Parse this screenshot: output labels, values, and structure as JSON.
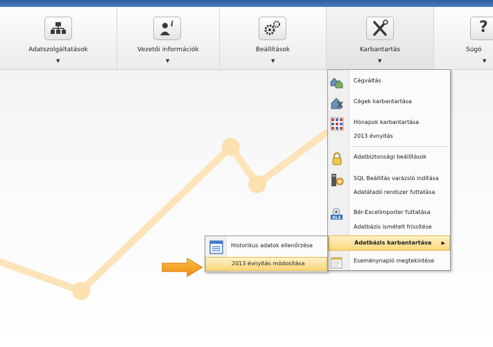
{
  "ribbon": {
    "buttons": [
      {
        "label": "Adatszolgáltatások",
        "icon": "org-chart-icon"
      },
      {
        "label": "Vezetői információk",
        "icon": "user-info-icon"
      },
      {
        "label": "Beállítások",
        "icon": "gears-icon"
      },
      {
        "label": "Karbantartás",
        "icon": "tools-icon"
      },
      {
        "label": "Súgó",
        "icon": "help-icon"
      }
    ],
    "dropdown_arrow": "▼"
  },
  "help_glyph": "?",
  "menu": {
    "items": [
      {
        "label": "Cégváltás",
        "icon": "company-switch-icon"
      },
      {
        "label": "Cégek karbantartása",
        "icon": "company-maintenance-icon"
      },
      {
        "label": "Hónapok karbantartása",
        "icon": "calendar-grid-icon"
      },
      {
        "label": "2013 évnyitás"
      },
      {
        "label": "Adatbiztonsági beállítások",
        "icon": "lock-icon"
      },
      {
        "label": "SQL Beállítás varázsló indítása",
        "icon": "sql-wizard-icon"
      },
      {
        "label": "Adatátadó rendszer futtatása"
      },
      {
        "label": "Bér-Excelimporter futtatása",
        "icon": "xls-import-icon"
      },
      {
        "label": "Adatbázis ismételt frissítése"
      },
      {
        "label": "Adatbázis karbantartása",
        "has_submenu": true,
        "highlighted": true
      },
      {
        "label": "Eseménynapló megtekintése",
        "icon": "event-log-icon"
      }
    ],
    "submenu_arrow": "▶"
  },
  "submenu": {
    "items": [
      {
        "label": "Historikus adatok ellenőrzése",
        "icon": "history-list-icon"
      },
      {
        "label": "2013 évnyitás módosítása",
        "highlighted": true
      }
    ]
  },
  "colors": {
    "accent_highlight": "#fcd67a",
    "chart_line": "#fde0b0",
    "arrow": "#f29b1c"
  }
}
